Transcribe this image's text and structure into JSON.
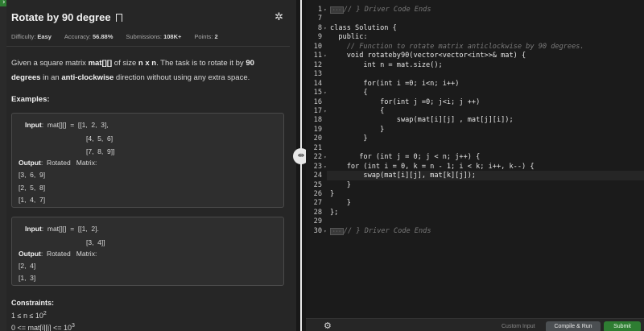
{
  "problem": {
    "title": "Rotate by 90 degree",
    "meta": {
      "difficulty_label": "Difficulty:",
      "difficulty": "Easy",
      "accuracy_label": "Accuracy:",
      "accuracy": "56.88%",
      "submissions_label": "Submissions:",
      "submissions": "108K+",
      "points_label": "Points:",
      "points": "2"
    },
    "desc": {
      "p1": "Given a square matrix ",
      "b1": "mat[][]",
      "p2": " of size ",
      "b2": "n x n",
      "p3": ". The task is to rotate it by ",
      "b3": "90 degrees",
      "p4": " in an ",
      "b4": "anti-clockwise",
      "p5": " direction without using any extra space."
    },
    "examples_heading": "Examples:",
    "example1": {
      "input_label": "Input",
      "input_l1": ":  mat[][]  =  [[1,  2,  3],",
      "input_l2": "[4,  5,  6]",
      "input_l3": "[7,  8,  9]]",
      "output_label": "Output",
      "output_l1": ":  Rotated   Matrix:",
      "out_r1": "[3,  6,  9]",
      "out_r2": "[2,  5,  8]",
      "out_r3": "[1,  4,  7]"
    },
    "example2": {
      "input_label": "Input",
      "input_l1": ":  mat[][]  =  [[1,  2].",
      "input_l2": "[3,  4]]",
      "output_label": "Output",
      "output_l1": ":  Rotated   Matrix:",
      "out_r1": "[2,  4]",
      "out_r2": "[1,  3]"
    },
    "constraints_heading": "Constraints:",
    "c1_pre": "1 ≤ n ≤ 10",
    "c1_sup": "2",
    "c2_pre": "0 <= mat[i][j] <= 10",
    "c2_sup": "3"
  },
  "editor": {
    "lines": [
      {
        "n": "1",
        "fold": true,
        "parts": [
          {
            "t": "hl",
            "v": "···"
          },
          {
            "t": "cmt",
            "v": "// } Driver Code Ends"
          }
        ]
      },
      {
        "n": "7",
        "fold": false,
        "parts": []
      },
      {
        "n": "8",
        "fold": true,
        "parts": [
          {
            "t": "code",
            "v": "class Solution {"
          }
        ]
      },
      {
        "n": "9",
        "fold": false,
        "parts": [
          {
            "t": "code",
            "v": "  public:"
          }
        ]
      },
      {
        "n": "10",
        "fold": false,
        "parts": [
          {
            "t": "cmt",
            "v": "    // Function to rotate matrix anticlockwise by 90 degrees."
          }
        ]
      },
      {
        "n": "11",
        "fold": true,
        "parts": [
          {
            "t": "code",
            "v": "    void rotateby90(vector<vector<int>>& mat) {"
          }
        ]
      },
      {
        "n": "12",
        "fold": false,
        "parts": [
          {
            "t": "code",
            "v": "        int n = mat.size();"
          }
        ]
      },
      {
        "n": "13",
        "fold": false,
        "parts": []
      },
      {
        "n": "14",
        "fold": false,
        "parts": [
          {
            "t": "code",
            "v": "        for(int i =0; i<n; i++)"
          }
        ]
      },
      {
        "n": "15",
        "fold": true,
        "parts": [
          {
            "t": "code",
            "v": "        {"
          }
        ]
      },
      {
        "n": "16",
        "fold": false,
        "parts": [
          {
            "t": "code",
            "v": "            for(int j =0; j<i; j ++)"
          }
        ]
      },
      {
        "n": "17",
        "fold": true,
        "parts": [
          {
            "t": "code",
            "v": "            {"
          }
        ]
      },
      {
        "n": "18",
        "fold": false,
        "parts": [
          {
            "t": "code",
            "v": "                swap(mat[i][j] , mat[j][i]);"
          }
        ]
      },
      {
        "n": "19",
        "fold": false,
        "parts": [
          {
            "t": "code",
            "v": "            }"
          }
        ]
      },
      {
        "n": "20",
        "fold": false,
        "parts": [
          {
            "t": "code",
            "v": "        }"
          }
        ]
      },
      {
        "n": "21",
        "fold": false,
        "parts": []
      },
      {
        "n": "22",
        "fold": true,
        "parts": [
          {
            "t": "code",
            "v": "       for (int j = 0; j < n; j++) {"
          }
        ]
      },
      {
        "n": "23",
        "fold": true,
        "parts": [
          {
            "t": "code",
            "v": "    for (int i = 0, k = n - 1; i < k; i++, k--) {"
          }
        ]
      },
      {
        "n": "24",
        "fold": false,
        "parts": [
          {
            "t": "code",
            "v": "        swap(mat[i][j], mat[k][j]);"
          }
        ]
      },
      {
        "n": "25",
        "fold": false,
        "parts": [
          {
            "t": "code",
            "v": "    }"
          }
        ]
      },
      {
        "n": "26",
        "fold": false,
        "parts": [
          {
            "t": "code",
            "v": "}"
          }
        ]
      },
      {
        "n": "27",
        "fold": false,
        "parts": [
          {
            "t": "code",
            "v": "    }"
          }
        ]
      },
      {
        "n": "28",
        "fold": false,
        "parts": [
          {
            "t": "code",
            "v": "};"
          }
        ]
      },
      {
        "n": "29",
        "fold": false,
        "parts": []
      },
      {
        "n": "30",
        "fold": true,
        "parts": [
          {
            "t": "hl",
            "v": "···"
          },
          {
            "t": "cmt",
            "v": "// } Driver Code Ends"
          }
        ]
      }
    ]
  },
  "footer": {
    "custom_input": "Custom Input",
    "compile_run": "Compile & Run",
    "submit": "Submit"
  },
  "icons": {
    "bookmark": "bookmark-icon",
    "bug": "bug-icon",
    "drag": "drag-handle-icon",
    "settings": "gear-icon",
    "fold": "chevron-down-icon"
  }
}
